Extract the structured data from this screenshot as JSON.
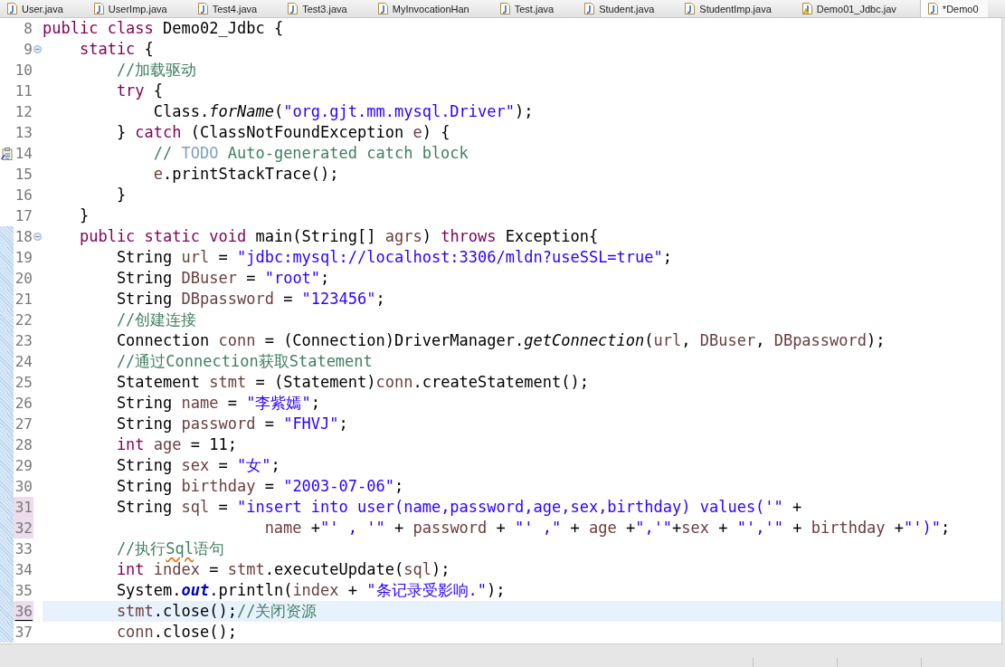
{
  "tabs": [
    {
      "label": "User.java",
      "selected": false,
      "warning": false
    },
    {
      "label": "UserImp.java",
      "selected": false,
      "warning": false
    },
    {
      "label": "Test4.java",
      "selected": false,
      "warning": false
    },
    {
      "label": "Test3.java",
      "selected": false,
      "warning": false
    },
    {
      "label": "MyInvocationHan",
      "selected": false,
      "warning": false
    },
    {
      "label": "Test.java",
      "selected": false,
      "warning": false
    },
    {
      "label": "Student.java",
      "selected": false,
      "warning": false
    },
    {
      "label": "StudentImp.java",
      "selected": false,
      "warning": false
    },
    {
      "label": "Demo01_Jdbc.jav",
      "selected": false,
      "warning": true
    },
    {
      "label": "*Demo0",
      "selected": true,
      "warning": false
    }
  ],
  "editor": {
    "lines": [
      {
        "number": "8",
        "foldable": false,
        "task": false,
        "diff": false,
        "changed": false,
        "current": false,
        "tokens": [
          {
            "kind": "keyword",
            "text": "public class"
          },
          {
            "kind": "plain",
            "text": " Demo02_Jdbc {"
          }
        ]
      },
      {
        "number": "9",
        "foldable": true,
        "task": false,
        "diff": false,
        "changed": false,
        "current": false,
        "tokens": [
          {
            "kind": "keyword",
            "text": "    static"
          },
          {
            "kind": "plain",
            "text": " {"
          }
        ]
      },
      {
        "number": "10",
        "foldable": false,
        "task": false,
        "diff": false,
        "changed": false,
        "current": false,
        "tokens": [
          {
            "kind": "comment",
            "text": "        //加载驱动"
          }
        ]
      },
      {
        "number": "11",
        "foldable": false,
        "task": false,
        "diff": false,
        "changed": false,
        "current": false,
        "tokens": [
          {
            "kind": "keyword",
            "text": "        try"
          },
          {
            "kind": "plain",
            "text": " {"
          }
        ]
      },
      {
        "number": "12",
        "foldable": false,
        "task": false,
        "diff": false,
        "changed": false,
        "current": false,
        "tokens": [
          {
            "kind": "plain",
            "text": "            Class."
          },
          {
            "kind": "static_method",
            "text": "forName"
          },
          {
            "kind": "plain",
            "text": "("
          },
          {
            "kind": "string",
            "text": "\"org.gjt.mm.mysql.Driver\""
          },
          {
            "kind": "plain",
            "text": ");"
          }
        ]
      },
      {
        "number": "13",
        "foldable": false,
        "task": false,
        "diff": false,
        "changed": false,
        "current": false,
        "tokens": [
          {
            "kind": "plain",
            "text": "        } "
          },
          {
            "kind": "keyword",
            "text": "catch"
          },
          {
            "kind": "plain",
            "text": " (ClassNotFoundException "
          },
          {
            "kind": "local",
            "text": "e"
          },
          {
            "kind": "plain",
            "text": ") {"
          }
        ]
      },
      {
        "number": "14",
        "foldable": false,
        "task": true,
        "diff": false,
        "changed": false,
        "current": false,
        "tokens": [
          {
            "kind": "comment",
            "text": "            // "
          },
          {
            "kind": "task_tag",
            "text": "TODO"
          },
          {
            "kind": "comment",
            "text": " Auto-generated catch block"
          }
        ]
      },
      {
        "number": "15",
        "foldable": false,
        "task": false,
        "diff": false,
        "changed": false,
        "current": false,
        "tokens": [
          {
            "kind": "local",
            "text": "            e"
          },
          {
            "kind": "plain",
            "text": ".printStackTrace();"
          }
        ]
      },
      {
        "number": "16",
        "foldable": false,
        "task": false,
        "diff": false,
        "changed": false,
        "current": false,
        "tokens": [
          {
            "kind": "plain",
            "text": "        }"
          }
        ]
      },
      {
        "number": "17",
        "foldable": false,
        "task": false,
        "diff": false,
        "changed": false,
        "current": false,
        "tokens": [
          {
            "kind": "plain",
            "text": "    }"
          }
        ]
      },
      {
        "number": "18",
        "foldable": true,
        "task": false,
        "diff": true,
        "changed": false,
        "current": false,
        "tokens": [
          {
            "kind": "keyword",
            "text": "    public static void"
          },
          {
            "kind": "plain",
            "text": " main(String[] "
          },
          {
            "kind": "local",
            "text": "agrs"
          },
          {
            "kind": "plain",
            "text": ") "
          },
          {
            "kind": "keyword",
            "text": "throws"
          },
          {
            "kind": "plain",
            "text": " Exception{"
          }
        ]
      },
      {
        "number": "19",
        "foldable": false,
        "task": false,
        "diff": true,
        "changed": false,
        "current": false,
        "tokens": [
          {
            "kind": "plain",
            "text": "        String "
          },
          {
            "kind": "local",
            "text": "url"
          },
          {
            "kind": "plain",
            "text": " = "
          },
          {
            "kind": "string",
            "text": "\"jdbc:mysql://localhost:3306/mldn?useSSL=true\""
          },
          {
            "kind": "plain",
            "text": ";"
          }
        ]
      },
      {
        "number": "20",
        "foldable": false,
        "task": false,
        "diff": true,
        "changed": false,
        "current": false,
        "tokens": [
          {
            "kind": "plain",
            "text": "        String "
          },
          {
            "kind": "local",
            "text": "DBuser"
          },
          {
            "kind": "plain",
            "text": " = "
          },
          {
            "kind": "string",
            "text": "\"root\""
          },
          {
            "kind": "plain",
            "text": ";"
          }
        ]
      },
      {
        "number": "21",
        "foldable": false,
        "task": false,
        "diff": true,
        "changed": false,
        "current": false,
        "tokens": [
          {
            "kind": "plain",
            "text": "        String "
          },
          {
            "kind": "local",
            "text": "DBpassword"
          },
          {
            "kind": "plain",
            "text": " = "
          },
          {
            "kind": "string",
            "text": "\"123456\""
          },
          {
            "kind": "plain",
            "text": ";"
          }
        ]
      },
      {
        "number": "22",
        "foldable": false,
        "task": false,
        "diff": true,
        "changed": false,
        "current": false,
        "tokens": [
          {
            "kind": "comment",
            "text": "        //创建连接"
          }
        ]
      },
      {
        "number": "23",
        "foldable": false,
        "task": false,
        "diff": true,
        "changed": false,
        "current": false,
        "tokens": [
          {
            "kind": "plain",
            "text": "        Connection "
          },
          {
            "kind": "local",
            "text": "conn"
          },
          {
            "kind": "plain",
            "text": " = (Connection)DriverManager."
          },
          {
            "kind": "static_method",
            "text": "getConnection"
          },
          {
            "kind": "plain",
            "text": "("
          },
          {
            "kind": "local",
            "text": "url"
          },
          {
            "kind": "plain",
            "text": ", "
          },
          {
            "kind": "local",
            "text": "DBuser"
          },
          {
            "kind": "plain",
            "text": ", "
          },
          {
            "kind": "local",
            "text": "DBpassword"
          },
          {
            "kind": "plain",
            "text": ");"
          }
        ]
      },
      {
        "number": "24",
        "foldable": false,
        "task": false,
        "diff": true,
        "changed": false,
        "current": false,
        "tokens": [
          {
            "kind": "comment",
            "text": "        //通过Connection获取Statement"
          }
        ]
      },
      {
        "number": "25",
        "foldable": false,
        "task": false,
        "diff": true,
        "changed": false,
        "current": false,
        "tokens": [
          {
            "kind": "plain",
            "text": "        Statement "
          },
          {
            "kind": "local",
            "text": "stmt"
          },
          {
            "kind": "plain",
            "text": " = (Statement)"
          },
          {
            "kind": "local",
            "text": "conn"
          },
          {
            "kind": "plain",
            "text": ".createStatement();"
          }
        ]
      },
      {
        "number": "26",
        "foldable": false,
        "task": false,
        "diff": true,
        "changed": false,
        "current": false,
        "tokens": [
          {
            "kind": "plain",
            "text": "        String "
          },
          {
            "kind": "local",
            "text": "name"
          },
          {
            "kind": "plain",
            "text": " = "
          },
          {
            "kind": "string",
            "text": "\"李紫嫣\""
          },
          {
            "kind": "plain",
            "text": ";"
          }
        ]
      },
      {
        "number": "27",
        "foldable": false,
        "task": false,
        "diff": true,
        "changed": false,
        "current": false,
        "tokens": [
          {
            "kind": "plain",
            "text": "        String "
          },
          {
            "kind": "local",
            "text": "password"
          },
          {
            "kind": "plain",
            "text": " = "
          },
          {
            "kind": "string",
            "text": "\"FHVJ\""
          },
          {
            "kind": "plain",
            "text": ";"
          }
        ]
      },
      {
        "number": "28",
        "foldable": false,
        "task": false,
        "diff": true,
        "changed": false,
        "current": false,
        "tokens": [
          {
            "kind": "keyword",
            "text": "        int"
          },
          {
            "kind": "local",
            "text": " age"
          },
          {
            "kind": "plain",
            "text": " = 11;"
          }
        ]
      },
      {
        "number": "29",
        "foldable": false,
        "task": false,
        "diff": true,
        "changed": false,
        "current": false,
        "tokens": [
          {
            "kind": "plain",
            "text": "        String "
          },
          {
            "kind": "local",
            "text": "sex"
          },
          {
            "kind": "plain",
            "text": " = "
          },
          {
            "kind": "string",
            "text": "\"女\""
          },
          {
            "kind": "plain",
            "text": ";"
          }
        ]
      },
      {
        "number": "30",
        "foldable": false,
        "task": false,
        "diff": true,
        "changed": false,
        "current": false,
        "tokens": [
          {
            "kind": "plain",
            "text": "        String "
          },
          {
            "kind": "local",
            "text": "birthday"
          },
          {
            "kind": "plain",
            "text": " = "
          },
          {
            "kind": "string",
            "text": "\"2003-07-06\""
          },
          {
            "kind": "plain",
            "text": ";"
          }
        ]
      },
      {
        "number": "31",
        "foldable": false,
        "task": false,
        "diff": true,
        "changed": true,
        "current": false,
        "tokens": [
          {
            "kind": "plain",
            "text": "        String "
          },
          {
            "kind": "local",
            "text": "sql"
          },
          {
            "kind": "plain",
            "text": " = "
          },
          {
            "kind": "string",
            "text": "\"insert into user(name,password,age,sex,birthday) values('\""
          },
          {
            "kind": "plain",
            "text": " +"
          }
        ]
      },
      {
        "number": "32",
        "foldable": false,
        "task": false,
        "diff": true,
        "changed": true,
        "current": false,
        "tokens": [
          {
            "kind": "local",
            "text": "                        name"
          },
          {
            "kind": "plain",
            "text": " +"
          },
          {
            "kind": "string",
            "text": "\"' , '\""
          },
          {
            "kind": "plain",
            "text": " + "
          },
          {
            "kind": "local",
            "text": "password"
          },
          {
            "kind": "plain",
            "text": " + "
          },
          {
            "kind": "string",
            "text": "\"' ,\""
          },
          {
            "kind": "plain",
            "text": " + "
          },
          {
            "kind": "local",
            "text": "age"
          },
          {
            "kind": "plain",
            "text": " +"
          },
          {
            "kind": "string",
            "text": "\",'\""
          },
          {
            "kind": "plain",
            "text": "+"
          },
          {
            "kind": "local",
            "text": "sex"
          },
          {
            "kind": "plain",
            "text": " + "
          },
          {
            "kind": "string",
            "text": "\"','\""
          },
          {
            "kind": "plain",
            "text": " + "
          },
          {
            "kind": "local",
            "text": "birthday"
          },
          {
            "kind": "plain",
            "text": " +"
          },
          {
            "kind": "string",
            "text": "\"')\""
          },
          {
            "kind": "plain",
            "text": ";"
          }
        ]
      },
      {
        "number": "33",
        "foldable": false,
        "task": false,
        "diff": true,
        "changed": false,
        "current": false,
        "tokens": [
          {
            "kind": "comment",
            "text": "        //执行"
          },
          {
            "kind": "misspelled",
            "text": "Sql"
          },
          {
            "kind": "comment",
            "text": "语句"
          }
        ]
      },
      {
        "number": "34",
        "foldable": false,
        "task": false,
        "diff": true,
        "changed": false,
        "current": false,
        "tokens": [
          {
            "kind": "keyword",
            "text": "        int"
          },
          {
            "kind": "local",
            "text": " index"
          },
          {
            "kind": "plain",
            "text": " = "
          },
          {
            "kind": "local",
            "text": "stmt"
          },
          {
            "kind": "plain",
            "text": ".executeUpdate("
          },
          {
            "kind": "local",
            "text": "sql"
          },
          {
            "kind": "plain",
            "text": ");"
          }
        ]
      },
      {
        "number": "35",
        "foldable": false,
        "task": false,
        "diff": true,
        "changed": false,
        "current": false,
        "tokens": [
          {
            "kind": "plain",
            "text": "        System."
          },
          {
            "kind": "static_field",
            "text": "out"
          },
          {
            "kind": "plain",
            "text": ".println("
          },
          {
            "kind": "local",
            "text": "index"
          },
          {
            "kind": "plain",
            "text": " + "
          },
          {
            "kind": "string",
            "text": "\"条记录受影响.\""
          },
          {
            "kind": "plain",
            "text": ");"
          }
        ]
      },
      {
        "number": "36",
        "foldable": false,
        "task": false,
        "diff": true,
        "changed": true,
        "current": true,
        "tokens": [
          {
            "kind": "local",
            "text": "        stmt"
          },
          {
            "kind": "plain",
            "text": ".close();"
          },
          {
            "kind": "comment",
            "text": "//关闭资源"
          }
        ]
      },
      {
        "number": "37",
        "foldable": false,
        "task": false,
        "diff": true,
        "changed": false,
        "current": false,
        "tokens": [
          {
            "kind": "local",
            "text": "        conn"
          },
          {
            "kind": "plain",
            "text": ".close();"
          }
        ]
      }
    ]
  }
}
